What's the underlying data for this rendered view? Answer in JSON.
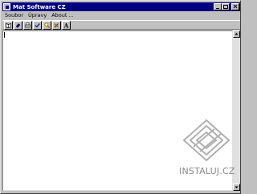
{
  "window": {
    "title": "Mat Software CZ",
    "buttons": [
      "minimize",
      "maximize",
      "close"
    ]
  },
  "menu": {
    "items": [
      "Soubor",
      "Úpravy",
      "About ..."
    ]
  },
  "toolbar": {
    "tools": [
      "book-icon",
      "eraser-icon",
      "print-icon",
      "check-icon",
      "search-icon",
      "tools-icon",
      "font-icon"
    ],
    "font_glyph": "A"
  },
  "editor": {
    "content": ""
  },
  "watermark": {
    "text": "INSTALUJ.CZ"
  },
  "colors": {
    "titlebar": "#000080",
    "window": "#c0c0c0",
    "editor_bg": "#ffffff",
    "watermark": "#8a8a8a"
  }
}
